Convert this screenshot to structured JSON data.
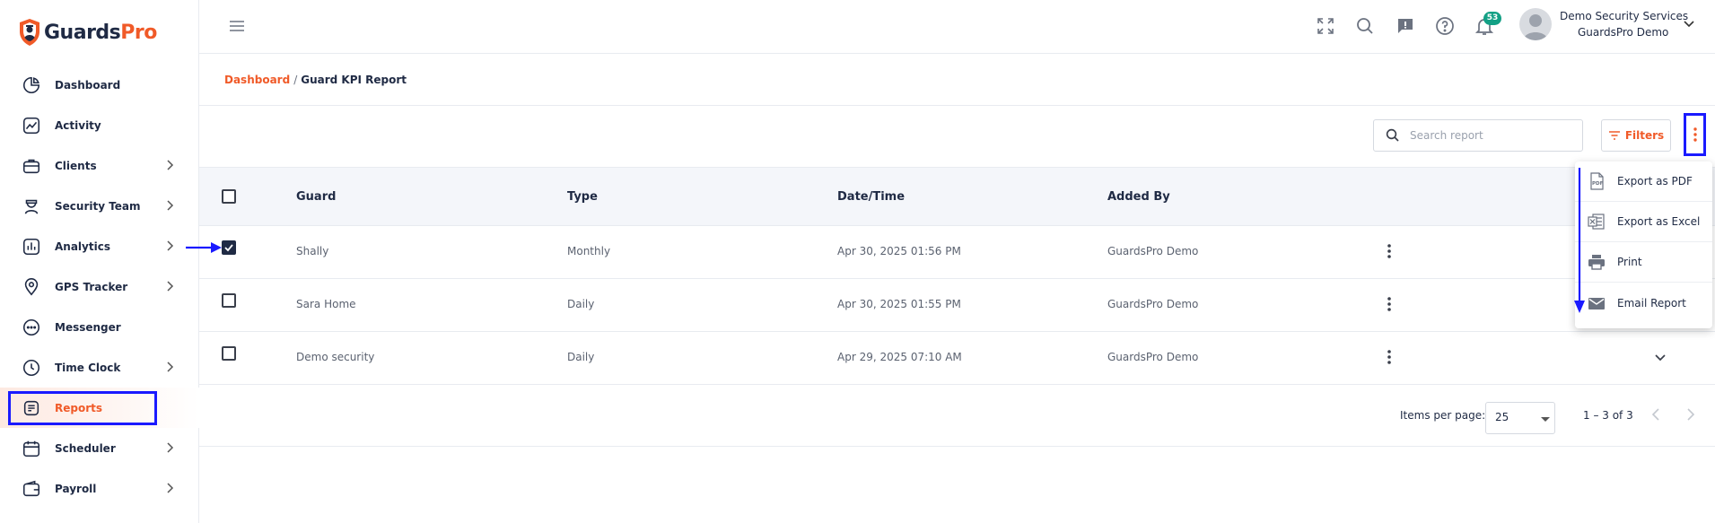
{
  "brand": {
    "name_a": "Guards",
    "name_b": "Pro",
    "accent": "#f05a28",
    "navy": "#1f2a44"
  },
  "sidebar": {
    "items": [
      {
        "label": "Dashboard",
        "icon": "pie-chart-icon",
        "chevron": false
      },
      {
        "label": "Activity",
        "icon": "activity-icon",
        "chevron": false
      },
      {
        "label": "Clients",
        "icon": "briefcase-icon",
        "chevron": true
      },
      {
        "label": "Security Team",
        "icon": "guard-icon",
        "chevron": true
      },
      {
        "label": "Analytics",
        "icon": "bar-chart-icon",
        "chevron": true
      },
      {
        "label": "GPS Tracker",
        "icon": "map-pin-icon",
        "chevron": true
      },
      {
        "label": "Messenger",
        "icon": "chat-icon",
        "chevron": false
      },
      {
        "label": "Time Clock",
        "icon": "clock-icon",
        "chevron": true
      },
      {
        "label": "Reports",
        "icon": "document-icon",
        "chevron": false,
        "active": true
      },
      {
        "label": "Scheduler",
        "icon": "calendar-icon",
        "chevron": true
      },
      {
        "label": "Payroll",
        "icon": "wallet-icon",
        "chevron": true
      }
    ]
  },
  "topbar": {
    "notification_count": "53",
    "user": {
      "company": "Demo Security Services",
      "name": "GuardsPro Demo"
    }
  },
  "breadcrumb": {
    "home": "Dashboard",
    "separator": "/",
    "current": "Guard KPI Report"
  },
  "toolbar": {
    "search_placeholder": "Search report",
    "filters_label": "Filters"
  },
  "table": {
    "headers": {
      "guard": "Guard",
      "type": "Type",
      "datetime": "Date/Time",
      "added_by": "Added By"
    },
    "rows": [
      {
        "guard": "Shally",
        "type": "Monthly",
        "datetime": "Apr 30, 2025 01:56 PM",
        "added_by": "GuardsPro Demo",
        "checked": true
      },
      {
        "guard": "Sara Home",
        "type": "Daily",
        "datetime": "Apr 30, 2025 01:55 PM",
        "added_by": "GuardsPro Demo",
        "checked": false
      },
      {
        "guard": "Demo security",
        "type": "Daily",
        "datetime": "Apr 29, 2025 07:10 AM",
        "added_by": "GuardsPro Demo",
        "checked": false
      }
    ]
  },
  "pagination": {
    "items_per_page_label": "Items per page:",
    "items_per_page": "25",
    "range": "1 – 3 of 3"
  },
  "export_menu": {
    "items": [
      {
        "label": "Export as PDF",
        "icon": "pdf-file-icon"
      },
      {
        "label": "Export as Excel",
        "icon": "excel-file-icon"
      },
      {
        "label": "Print",
        "icon": "printer-icon"
      },
      {
        "label": "Email Report",
        "icon": "email-icon"
      }
    ]
  },
  "annotation_color": "#1a1aff"
}
